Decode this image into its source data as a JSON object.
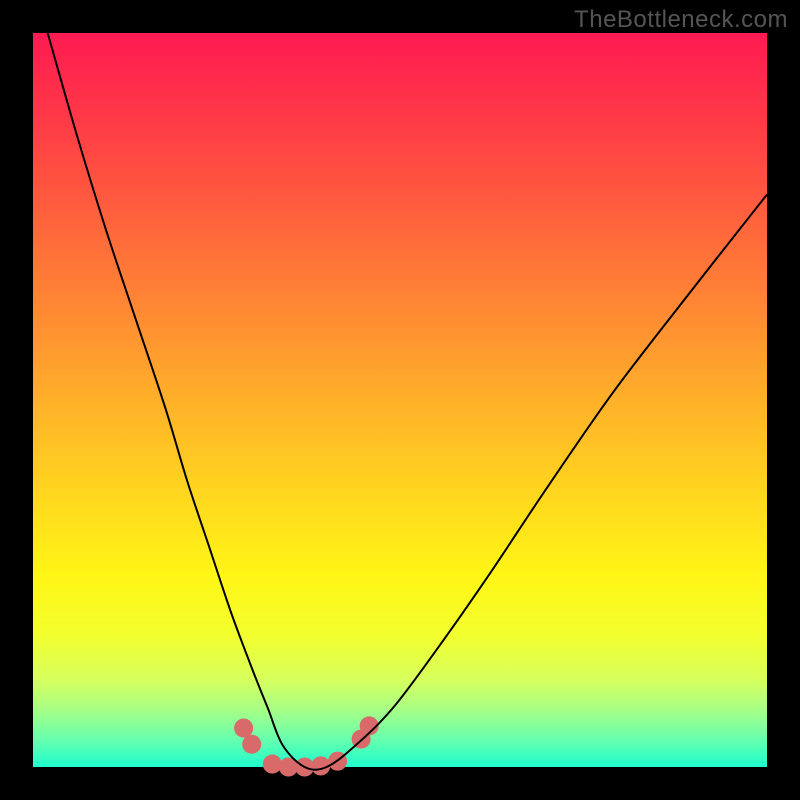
{
  "watermark": "TheBottleneck.com",
  "chart_data": {
    "type": "line",
    "title": "",
    "xlabel": "",
    "ylabel": "",
    "xlim": [
      0,
      100
    ],
    "ylim": [
      0,
      100
    ],
    "series": [
      {
        "name": "bottleneck-curve",
        "x": [
          2,
          6,
          10,
          14,
          18,
          21,
          24,
          27,
          30,
          32,
          34,
          37,
          40,
          44,
          49,
          55,
          62,
          70,
          79,
          89,
          100
        ],
        "values": [
          100,
          86,
          73,
          61,
          49,
          39,
          30,
          21,
          13,
          8,
          3,
          0,
          0,
          3,
          8,
          16,
          26,
          38,
          51,
          64,
          78
        ]
      }
    ],
    "markers": [
      {
        "x_pct": 28.7,
        "y_pct_from_bottom": 5.3
      },
      {
        "x_pct": 29.8,
        "y_pct_from_bottom": 3.1
      },
      {
        "x_pct": 32.6,
        "y_pct_from_bottom": 0.4
      },
      {
        "x_pct": 34.8,
        "y_pct_from_bottom": 0.0
      },
      {
        "x_pct": 37.0,
        "y_pct_from_bottom": 0.0
      },
      {
        "x_pct": 39.2,
        "y_pct_from_bottom": 0.15
      },
      {
        "x_pct": 41.5,
        "y_pct_from_bottom": 0.8
      },
      {
        "x_pct": 44.7,
        "y_pct_from_bottom": 3.8
      },
      {
        "x_pct": 45.8,
        "y_pct_from_bottom": 5.6
      }
    ],
    "marker_radius_pct": 1.3,
    "marker_color": "#d86a6a",
    "curve_color": "#000000",
    "curve_width": 2
  }
}
